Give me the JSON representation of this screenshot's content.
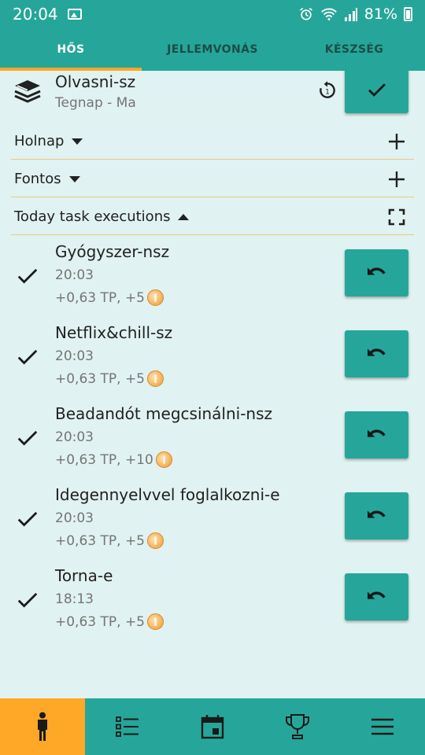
{
  "status": {
    "time": "20:04",
    "battery": "81%"
  },
  "tabs": [
    {
      "label": "HŐS",
      "active": true
    },
    {
      "label": "JELLEMVONÁS",
      "active": false
    },
    {
      "label": "KÉSZSÉG",
      "active": false
    }
  ],
  "current_task": {
    "title": "Olvasni-sz",
    "subtitle": "Tegnap - Ma",
    "icon": "books-icon"
  },
  "sections": {
    "tomorrow": "Holnap",
    "important": "Fontos",
    "today": "Today task executions"
  },
  "executions": [
    {
      "title": "Gyógyszer-nsz",
      "time": "20:03",
      "reward": "+0,63 TP, +5"
    },
    {
      "title": "Netflix&chill-sz",
      "time": "20:03",
      "reward": "+0,63 TP, +5"
    },
    {
      "title": "Beadandót megcsinálni-nsz",
      "time": "20:03",
      "reward": "+0,63 TP, +10"
    },
    {
      "title": "Idegennyelvvel foglalkozni-e",
      "time": "20:03",
      "reward": "+0,63 TP, +5"
    },
    {
      "title": "Torna-e",
      "time": "18:13",
      "reward": "+0,63 TP, +5"
    }
  ],
  "nav": [
    "person-icon",
    "list-icon",
    "calendar-icon",
    "trophy-icon",
    "menu-icon"
  ],
  "colors": {
    "primary": "#26a69a",
    "accent": "#ffa726",
    "background": "#e0f2f1"
  }
}
